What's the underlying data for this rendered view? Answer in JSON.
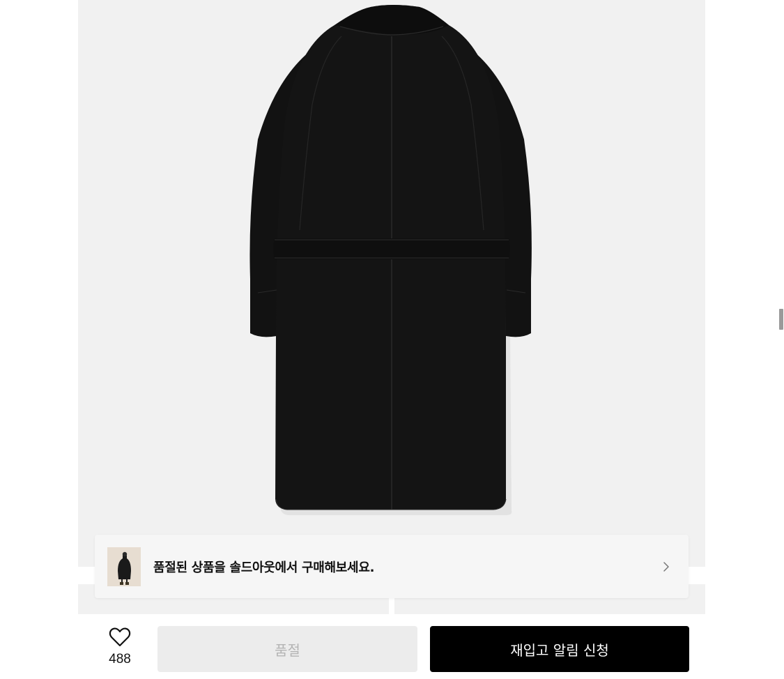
{
  "product": {
    "image_alt": "black wool coat back view"
  },
  "soldout_banner": {
    "message": "품절된 상품을 솔드아웃에서 구매해보세요.",
    "chevron_icon": "chevron-right-icon"
  },
  "bottom_bar": {
    "like_icon": "heart-icon",
    "like_count": "488",
    "soldout_label": "품절",
    "restock_label": "재입고 알림 신청"
  },
  "colors": {
    "image_bg": "#f1f1f1",
    "banner_bg": "#f6f6f6",
    "soldout_btn_bg": "#ececec",
    "soldout_btn_text": "#b4b4b4",
    "restock_btn_bg": "#000000",
    "restock_btn_text": "#ffffff",
    "coat": "#111111"
  }
}
